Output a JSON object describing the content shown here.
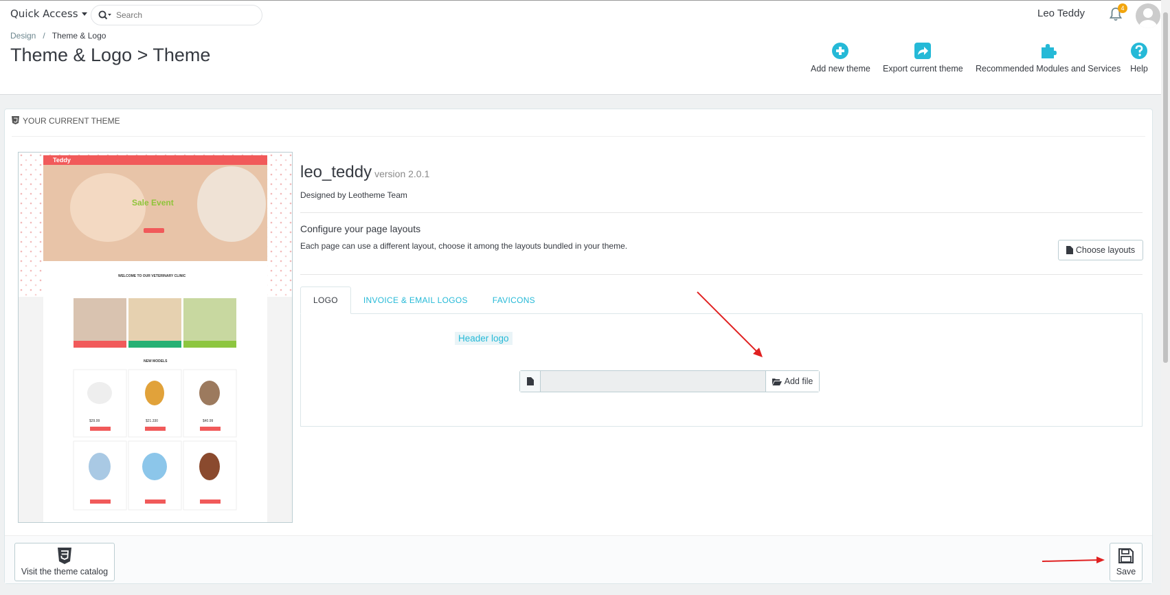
{
  "header": {
    "quick_access": "Quick Access",
    "search_placeholder": "Search",
    "user_name": "Leo Teddy",
    "notifications_count": "4"
  },
  "breadcrumb": {
    "parent": "Design",
    "separator": "/",
    "current": "Theme & Logo"
  },
  "page_title": "Theme & Logo > Theme",
  "toolbar": {
    "add_theme": "Add new theme",
    "export_theme": "Export current theme",
    "recommended": "Recommended Modules and Services",
    "help": "Help"
  },
  "panel": {
    "heading": "YOUR CURRENT THEME",
    "theme_name": "leo_teddy",
    "theme_version": "version 2.0.1",
    "designed_by": "Designed by Leotheme Team",
    "configure_title": "Configure your page layouts",
    "configure_desc": "Each page can use a different layout, choose it among the layouts bundled in your theme.",
    "choose_layouts": "Choose layouts",
    "tabs": [
      "LOGO",
      "INVOICE & EMAIL LOGOS",
      "FAVICONS"
    ],
    "header_logo": "Header logo",
    "add_file": "Add file",
    "catalog_button": "Visit the theme catalog",
    "save_button": "Save"
  },
  "preview": {
    "brand": "Teddy",
    "hero_text": "Sale Event",
    "welcome": "WELCOME TO OUR VETERINARY CLINIC",
    "new_models": "NEW MODELS",
    "price1": "$29.99",
    "price2": "$21.330",
    "price3": "$40.99"
  },
  "colors": {
    "accent": "#25b9d7",
    "preview_red": "#f15a5a",
    "annotation": "#e02020"
  }
}
